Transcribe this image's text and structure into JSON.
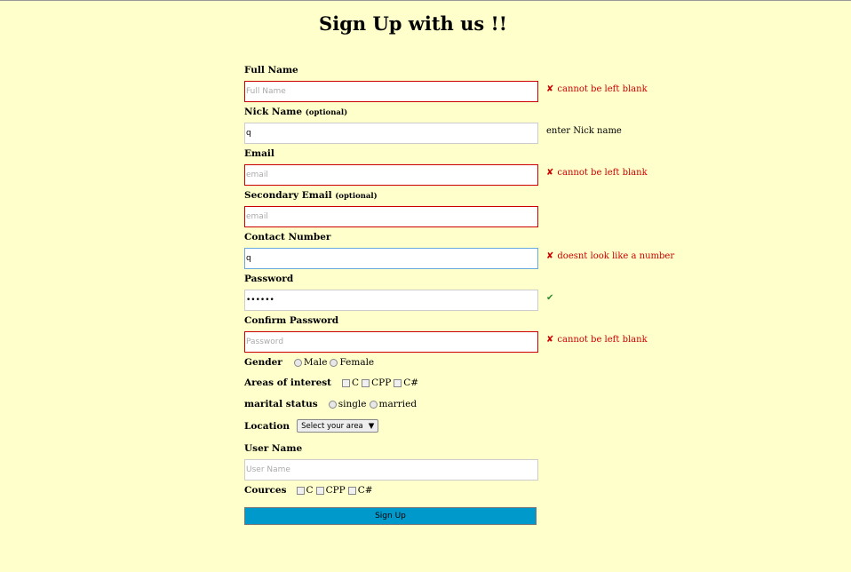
{
  "title": "Sign Up with us !!",
  "fields": {
    "full_name": {
      "label": "Full Name",
      "placeholder": "Full Name",
      "value": "",
      "message": "cannot be left blank"
    },
    "nick_name": {
      "label": "Nick Name",
      "optional": "(optional)",
      "placeholder": "",
      "value": "q",
      "message": "enter Nick name"
    },
    "email": {
      "label": "Email",
      "placeholder": "email",
      "value": "",
      "message": "cannot be left blank"
    },
    "secondary_email": {
      "label": "Secondary Email",
      "optional": "(optional)",
      "placeholder": "email",
      "value": ""
    },
    "contact": {
      "label": "Contact Number",
      "placeholder": "",
      "value": "q",
      "message": "doesnt look like a number"
    },
    "password": {
      "label": "Password",
      "placeholder": "",
      "value": "••••••",
      "message": "✔"
    },
    "confirm_password": {
      "label": "Confirm Password",
      "placeholder": "Password",
      "value": "",
      "message": "cannot be left blank"
    },
    "user_name": {
      "label": "User Name",
      "placeholder": "User Name",
      "value": ""
    }
  },
  "gender": {
    "label": "Gender",
    "options": [
      "Male",
      "Female"
    ]
  },
  "interests": {
    "label": "Areas of interest",
    "options": [
      "C",
      "CPP",
      "C#"
    ]
  },
  "marital": {
    "label": "marital status",
    "options": [
      "single",
      "married"
    ]
  },
  "location": {
    "label": "Location",
    "selected": "Select your area"
  },
  "cources": {
    "label": "Cources",
    "options": [
      "C",
      "CPP",
      "C#"
    ]
  },
  "error_mark": "✘",
  "submit_label": "Sign Up"
}
